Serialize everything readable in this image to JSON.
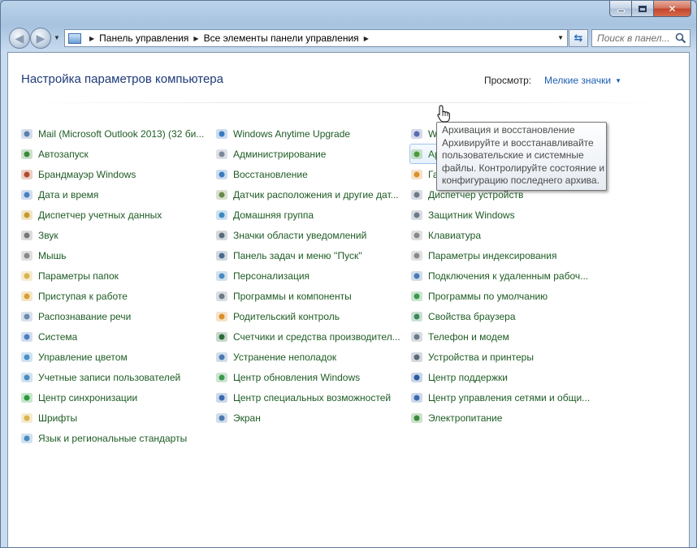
{
  "window": {
    "minimize": "minimize",
    "maximize": "maximize",
    "close": "✕"
  },
  "navbar": {
    "breadcrumbs": [
      "Панель управления",
      "Все элементы панели управления"
    ],
    "search_placeholder": "Поиск в панел..."
  },
  "header": {
    "title": "Настройка параметров компьютера",
    "view_label": "Просмотр:",
    "view_value": "Мелкие значки"
  },
  "columns": [
    [
      {
        "label": "Mail (Microsoft Outlook 2013) (32 би...",
        "icon": "mail-icon",
        "color": "#5a7fb0"
      },
      {
        "label": "Автозапуск",
        "icon": "autoplay-icon",
        "color": "#3a8a3a"
      },
      {
        "label": "Брандмауэр Windows",
        "icon": "firewall-icon",
        "color": "#b44a2a"
      },
      {
        "label": "Дата и время",
        "icon": "clock-icon",
        "color": "#4a7fc0"
      },
      {
        "label": "Диспетчер учетных данных",
        "icon": "credential-icon",
        "color": "#c89a2a"
      },
      {
        "label": "Звук",
        "icon": "speaker-icon",
        "color": "#777777"
      },
      {
        "label": "Мышь",
        "icon": "mouse-icon",
        "color": "#888888"
      },
      {
        "label": "Параметры папок",
        "icon": "folder-icon",
        "color": "#d9b44a"
      },
      {
        "label": "Приступая к работе",
        "icon": "getting-started-icon",
        "color": "#d9a030"
      },
      {
        "label": "Распознавание речи",
        "icon": "microphone-icon",
        "color": "#6a8ab0"
      },
      {
        "label": "Система",
        "icon": "system-icon",
        "color": "#4a7fc0"
      },
      {
        "label": "Управление цветом",
        "icon": "color-management-icon",
        "color": "#4a90c8"
      },
      {
        "label": "Учетные записи пользователей",
        "icon": "users-icon",
        "color": "#4a8ac0"
      },
      {
        "label": "Центр синхронизации",
        "icon": "sync-icon",
        "color": "#2a9a3a"
      },
      {
        "label": "Шрифты",
        "icon": "fonts-icon",
        "color": "#d9b44a"
      },
      {
        "label": "Язык и региональные стандарты",
        "icon": "globe-icon",
        "color": "#4a8ac0"
      }
    ],
    [
      {
        "label": "Windows Anytime Upgrade",
        "icon": "windows-logo-icon",
        "color": "#3a7ac0"
      },
      {
        "label": "Администрирование",
        "icon": "admin-tools-icon",
        "color": "#7a8a9a"
      },
      {
        "label": "Восстановление",
        "icon": "recovery-icon",
        "color": "#3a7ac0"
      },
      {
        "label": "Датчик расположения и другие дат...",
        "icon": "sensor-icon",
        "color": "#6a8a4a"
      },
      {
        "label": "Домашняя группа",
        "icon": "homegroup-icon",
        "color": "#3a8ac0"
      },
      {
        "label": "Значки области уведомлений",
        "icon": "notification-icon",
        "color": "#5a6a7a"
      },
      {
        "label": "Панель задач и меню ''Пуск''",
        "icon": "taskbar-icon",
        "color": "#4a6a8a"
      },
      {
        "label": "Персонализация",
        "icon": "personalization-icon",
        "color": "#4a8ac0"
      },
      {
        "label": "Программы и компоненты",
        "icon": "programs-icon",
        "color": "#6a7a8a"
      },
      {
        "label": "Родительский контроль",
        "icon": "parental-control-icon",
        "color": "#d9902a"
      },
      {
        "label": "Счетчики и средства производител...",
        "icon": "performance-icon",
        "color": "#2a6a3a"
      },
      {
        "label": "Устранение неполадок",
        "icon": "troubleshooting-icon",
        "color": "#4a7ab0"
      },
      {
        "label": "Центр обновления Windows",
        "icon": "windows-update-icon",
        "color": "#3a9a4a"
      },
      {
        "label": "Центр специальных возможностей",
        "icon": "accessibility-icon",
        "color": "#3a6ab0"
      },
      {
        "label": "Экран",
        "icon": "display-icon",
        "color": "#4a7ab0"
      }
    ],
    [
      {
        "label": "Windows CardSpace",
        "icon": "cardspace-icon",
        "color": "#5a6ab0"
      },
      {
        "label": "Архивация и восстановление",
        "icon": "backup-icon",
        "color": "#4a9a3a",
        "hover": true
      },
      {
        "label": "Гаджеты рабочего стола",
        "icon": "gadgets-icon",
        "color": "#d9902a"
      },
      {
        "label": "Диспетчер устройств",
        "icon": "device-manager-icon",
        "color": "#6a7a8a"
      },
      {
        "label": "Защитник Windows",
        "icon": "defender-icon",
        "color": "#6a7a8a"
      },
      {
        "label": "Клавиатура",
        "icon": "keyboard-icon",
        "color": "#888888"
      },
      {
        "label": "Параметры индексирования",
        "icon": "indexing-icon",
        "color": "#8a8a8a"
      },
      {
        "label": "Подключения к удаленным рабоч...",
        "icon": "remote-desktop-icon",
        "color": "#4a7ab0"
      },
      {
        "label": "Программы по умолчанию",
        "icon": "default-programs-icon",
        "color": "#3a9a4a"
      },
      {
        "label": "Свойства браузера",
        "icon": "internet-options-icon",
        "color": "#3a8a5a"
      },
      {
        "label": "Телефон и модем",
        "icon": "phone-icon",
        "color": "#6a7a8a"
      },
      {
        "label": "Устройства и принтеры",
        "icon": "printer-icon",
        "color": "#5a6a7a"
      },
      {
        "label": "Центр поддержки",
        "icon": "action-center-flag-icon",
        "color": "#2a5aa0"
      },
      {
        "label": "Центр управления сетями и общи...",
        "icon": "network-icon",
        "color": "#3a6ab0"
      },
      {
        "label": "Электропитание",
        "icon": "power-icon",
        "color": "#3a8a3a"
      }
    ]
  ],
  "tooltip": {
    "lines": [
      "Архивация и восстановление",
      "Архивируйте и восстанавливайте",
      "пользовательские и системные",
      "файлы. Контролируйте состояние и",
      "конфигурацию последнего архива."
    ]
  }
}
